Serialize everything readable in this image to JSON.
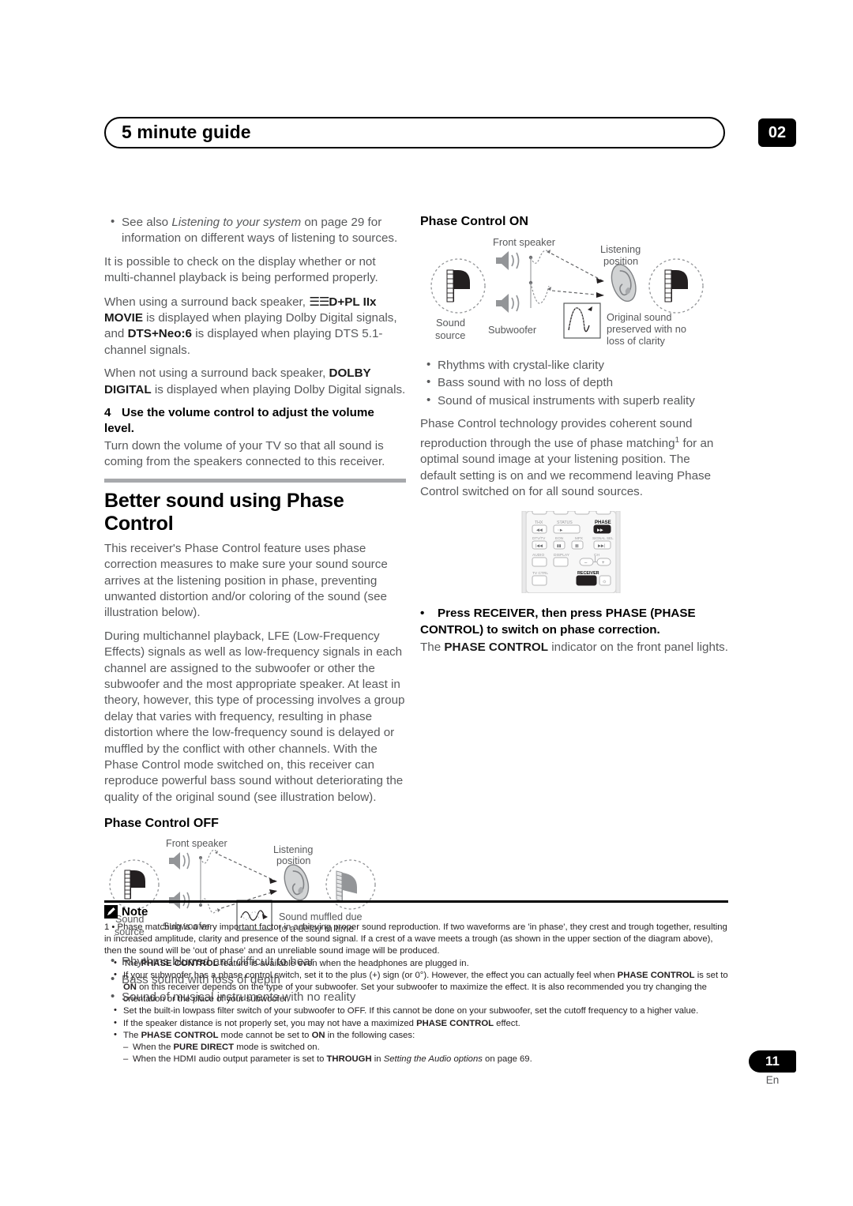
{
  "header": {
    "title": "5 minute guide",
    "chapter": "02"
  },
  "footer": {
    "page_number": "11",
    "language": "En"
  },
  "left_column": {
    "see_also_bullet": {
      "pre": "See also ",
      "italic": "Listening to your system",
      "post": " on page 29 for information on different ways of listening to sources."
    },
    "para_display_check": "It is possible to check on the display whether or not multi-channel playback is being performed properly.",
    "para_surround_back": {
      "p1": "When using a surround back speaker, ",
      "dolby_mark": "☰☰",
      "b1": "D+PL IIx MOVIE",
      "p2": " is displayed when playing Dolby Digital signals, and ",
      "b2": "DTS+Neo:6",
      "p3": " is displayed when playing DTS 5.1-channel signals."
    },
    "para_no_surround_back": {
      "p1": "When not using a surround back speaker, ",
      "b1": "DOLBY DIGITAL",
      "p2": " is displayed when playing Dolby Digital signals."
    },
    "step4": {
      "number": "4",
      "title": "Use the volume control to adjust the volume level.",
      "body": "Turn down the volume of your TV so that all sound is coming from the speakers connected to this receiver."
    },
    "section_title": "Better sound using Phase Control",
    "para_phase_1": "This receiver's Phase Control feature uses phase correction measures to make sure your sound source arrives at the listening position in phase, preventing unwanted distortion and/or coloring of the sound (see illustration below).",
    "para_phase_2": "During multichannel playback, LFE (Low-Frequency Effects) signals as well as low-frequency signals in each channel are assigned to the subwoofer or other the subwoofer and the most appropriate speaker. At least in theory, however, this type of processing involves a group delay that varies with frequency, resulting in phase distortion where the low-frequency sound is delayed or muffled by the conflict with other channels. With the Phase Control mode switched on, this receiver can reproduce powerful bass sound without deteriorating the quality of the original sound (see illustration below).",
    "phase_off": {
      "title": "Phase Control OFF",
      "labels": {
        "front_speaker": "Front speaker",
        "listening_position_l1": "Listening",
        "listening_position_l2": "position",
        "sound_source_l1": "Sound",
        "sound_source_l2": "source",
        "subwoofer": "Subwoofer",
        "result_l1": "Sound muffled due",
        "result_l2": "to a delay in time"
      },
      "bullets": [
        "Rhythms blurred and difficult to hear",
        "Bass sound with loss of depth",
        "Sound of musical instruments with no reality"
      ]
    }
  },
  "right_column": {
    "phase_on": {
      "title": "Phase Control ON",
      "labels": {
        "front_speaker": "Front speaker",
        "listening_position_l1": "Listening",
        "listening_position_l2": "position",
        "sound_source_l1": "Sound",
        "sound_source_l2": "source",
        "subwoofer": "Subwoofer",
        "result_l1": "Original sound",
        "result_l2": "preserved with no",
        "result_l3": "loss of clarity"
      },
      "bullets": [
        "Rhythms with crystal-like clarity",
        "Bass sound with no loss of depth",
        "Sound of musical instruments with superb reality"
      ]
    },
    "para_technology": {
      "p1": "Phase Control technology provides coherent sound reproduction through the use of phase matching",
      "sup": "1",
      "p2": " for an optimal sound image at your listening position. The default setting is on and we recommend leaving Phase Control switched on for all sound sources."
    },
    "remote": {
      "row1": [
        "THX",
        "STATUS",
        "PHASE"
      ],
      "row2": [
        "DTV/TV",
        "EON",
        "MPX",
        "SIGNAL SEL"
      ],
      "row3": [
        "AUDIO",
        "DISPLAY",
        "CH"
      ],
      "ch_minus": "–",
      "ch_plus": "+",
      "row4": [
        "TV CTRL",
        "RECEIVER"
      ]
    },
    "instruction": {
      "bullet_b1": "Press RECEIVER, then press PHASE (PHASE CONTROL) to switch on phase correction.",
      "follow_p1": "The ",
      "follow_b1": "PHASE CONTROL",
      "follow_p2": " indicator on the front panel lights."
    }
  },
  "note": {
    "label": "Note",
    "footnote_1": {
      "marker": "1",
      "text": "Phase matching is a very important factor in achieving proper sound reproduction. If two waveforms are 'in phase', they crest and trough together, resulting in increased amplitude, clarity and presence of the sound signal. If a crest of a wave meets a trough (as shown in the upper section of the diagram above), then the sound will be 'out of phase' and an unreliable sound image will be produced."
    },
    "bullet_headphones": {
      "p1": "The ",
      "b1": "PHASE CONTROL",
      "p2": " feature is available even when the headphones are plugged in."
    },
    "bullet_subwoofer_switch": {
      "p1": "If your subwoofer has a phase control switch, set it to the plus (+) sign (or 0°). However, the effect you can actually feel when ",
      "b1": "PHASE CONTROL",
      "p2": " is set to ",
      "b2": "ON",
      "p3": " on this receiver depends on the type of your subwoofer. Set your subwoofer to maximize the effect. It is also recommended you try changing the orientation or the place of your subwoofer."
    },
    "bullet_lowpass": "Set the built-in lowpass filter switch of your subwoofer to OFF. If this cannot be done on your subwoofer, set the cutoff frequency to a higher value.",
    "bullet_speaker_distance": {
      "p1": "If the speaker distance is not properly set, you may not have a maximized ",
      "b1": "PHASE CONTROL",
      "p2": " effect."
    },
    "bullet_cannot_on": {
      "p1": "The ",
      "b1": "PHASE CONTROL",
      "p2": " mode cannot be set to ",
      "b2": "ON",
      "p3": " in the following cases:"
    },
    "sub_pure_direct": {
      "p1": "When the ",
      "b1": "PURE DIRECT",
      "p2": " mode is switched on."
    },
    "sub_hdmi": {
      "p1": "When the HDMI audio output parameter is set to ",
      "b1": "THROUGH",
      "p2": " in ",
      "i1": "Setting the Audio options",
      "p3": " on page 69."
    }
  },
  "colors": {
    "text": "#58595b",
    "heading": "#000000",
    "rule_gray": "#a7a9ac",
    "diagram_gray": "#939598",
    "diagram_dark": "#231f20"
  }
}
